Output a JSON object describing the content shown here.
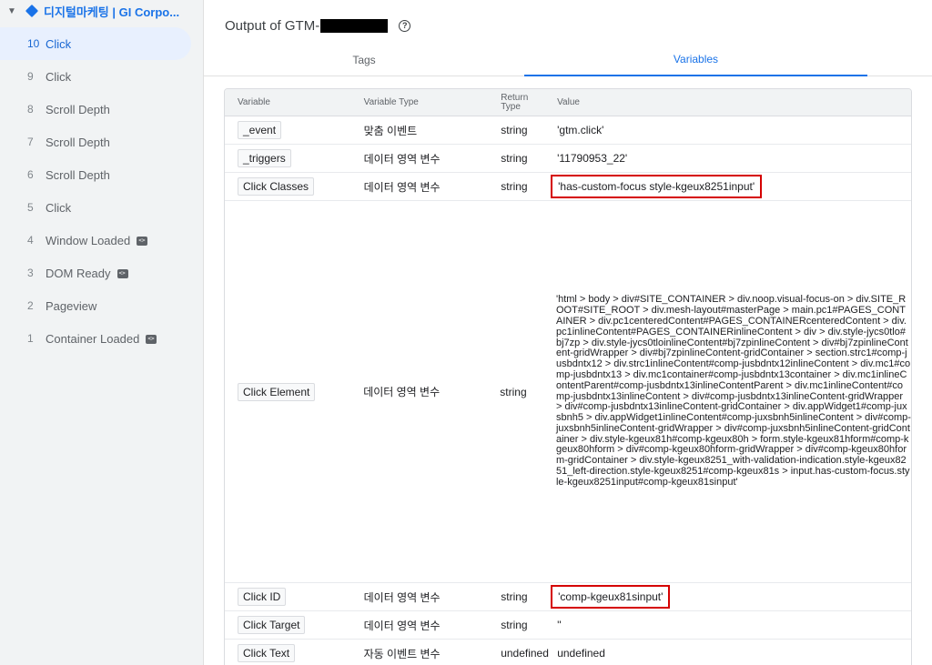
{
  "sidebar": {
    "container_name": "디지털마케팅 | GI Corpo...",
    "events": [
      {
        "num": "10",
        "label": "Click",
        "selected": true,
        "code": false
      },
      {
        "num": "9",
        "label": "Click",
        "selected": false,
        "code": false
      },
      {
        "num": "8",
        "label": "Scroll Depth",
        "selected": false,
        "code": false
      },
      {
        "num": "7",
        "label": "Scroll Depth",
        "selected": false,
        "code": false
      },
      {
        "num": "6",
        "label": "Scroll Depth",
        "selected": false,
        "code": false
      },
      {
        "num": "5",
        "label": "Click",
        "selected": false,
        "code": false
      },
      {
        "num": "4",
        "label": "Window Loaded",
        "selected": false,
        "code": true
      },
      {
        "num": "3",
        "label": "DOM Ready",
        "selected": false,
        "code": true
      },
      {
        "num": "2",
        "label": "Pageview",
        "selected": false,
        "code": false
      },
      {
        "num": "1",
        "label": "Container Loaded",
        "selected": false,
        "code": true
      }
    ]
  },
  "header": {
    "title_prefix": "Output of GTM-"
  },
  "tabs": {
    "tags": "Tags",
    "variables": "Variables"
  },
  "table": {
    "headers": {
      "variable": "Variable",
      "type": "Variable Type",
      "return_type": "Return Type",
      "value": "Value"
    },
    "rows": [
      {
        "name": "_event",
        "type": "맞춤 이벤트",
        "ret": "string",
        "value": "'gtm.click'",
        "highlight": false
      },
      {
        "name": "_triggers",
        "type": "데이터 영역 변수",
        "ret": "string",
        "value": "'11790953_22'",
        "highlight": false
      },
      {
        "name": "Click Classes",
        "type": "데이터 영역 변수",
        "ret": "string",
        "value": "'has-custom-focus style-kgeux8251input'",
        "highlight": true
      },
      {
        "name": "Click Element",
        "type": "데이터 영역 변수",
        "ret": "string",
        "value": "'html > body > div#SITE_CONTAINER > div.noop.visual-focus-on > div.SITE_ROOT#SITE_ROOT > div.mesh-layout#masterPage > main.pc1#PAGES_CONTAINER > div.pc1centeredContent#PAGES_CONTAINERcenteredContent > div.pc1inlineContent#PAGES_CONTAINERinlineContent > div > div.style-jycs0tlo#bj7zp > div.style-jycs0tloinlineContent#bj7zpinlineContent > div#bj7zpinlineContent-gridWrapper > div#bj7zpinlineContent-gridContainer > section.strc1#comp-jusbdntx12 > div.strc1inlineContent#comp-jusbdntx12inlineContent > div.mc1#comp-jusbdntx13 > div.mc1container#comp-jusbdntx13container > div.mc1inlineContentParent#comp-jusbdntx13inlineContentParent > div.mc1inlineContent#comp-jusbdntx13inlineContent > div#comp-jusbdntx13inlineContent-gridWrapper > div#comp-jusbdntx13inlineContent-gridContainer > div.appWidget1#comp-juxsbnh5 > div.appWidget1inlineContent#comp-juxsbnh5inlineContent > div#comp-juxsbnh5inlineContent-gridWrapper > div#comp-juxsbnh5inlineContent-gridContainer > div.style-kgeux81h#comp-kgeux80h > form.style-kgeux81hform#comp-kgeux80hform > div#comp-kgeux80hform-gridWrapper > div#comp-kgeux80hform-gridContainer > div.style-kgeux8251_with-validation-indication.style-kgeux8251_left-direction.style-kgeux8251#comp-kgeux81s > input.has-custom-focus.style-kgeux8251input#comp-kgeux81sinput'",
        "highlight": false
      },
      {
        "name": "Click ID",
        "type": "데이터 영역 변수",
        "ret": "string",
        "value": "'comp-kgeux81sinput'",
        "highlight": true
      },
      {
        "name": "Click Target",
        "type": "데이터 영역 변수",
        "ret": "string",
        "value": "''",
        "highlight": false
      },
      {
        "name": "Click Text",
        "type": "자동 이벤트 변수",
        "ret": "undefined",
        "value": "undefined",
        "highlight": false
      }
    ]
  }
}
